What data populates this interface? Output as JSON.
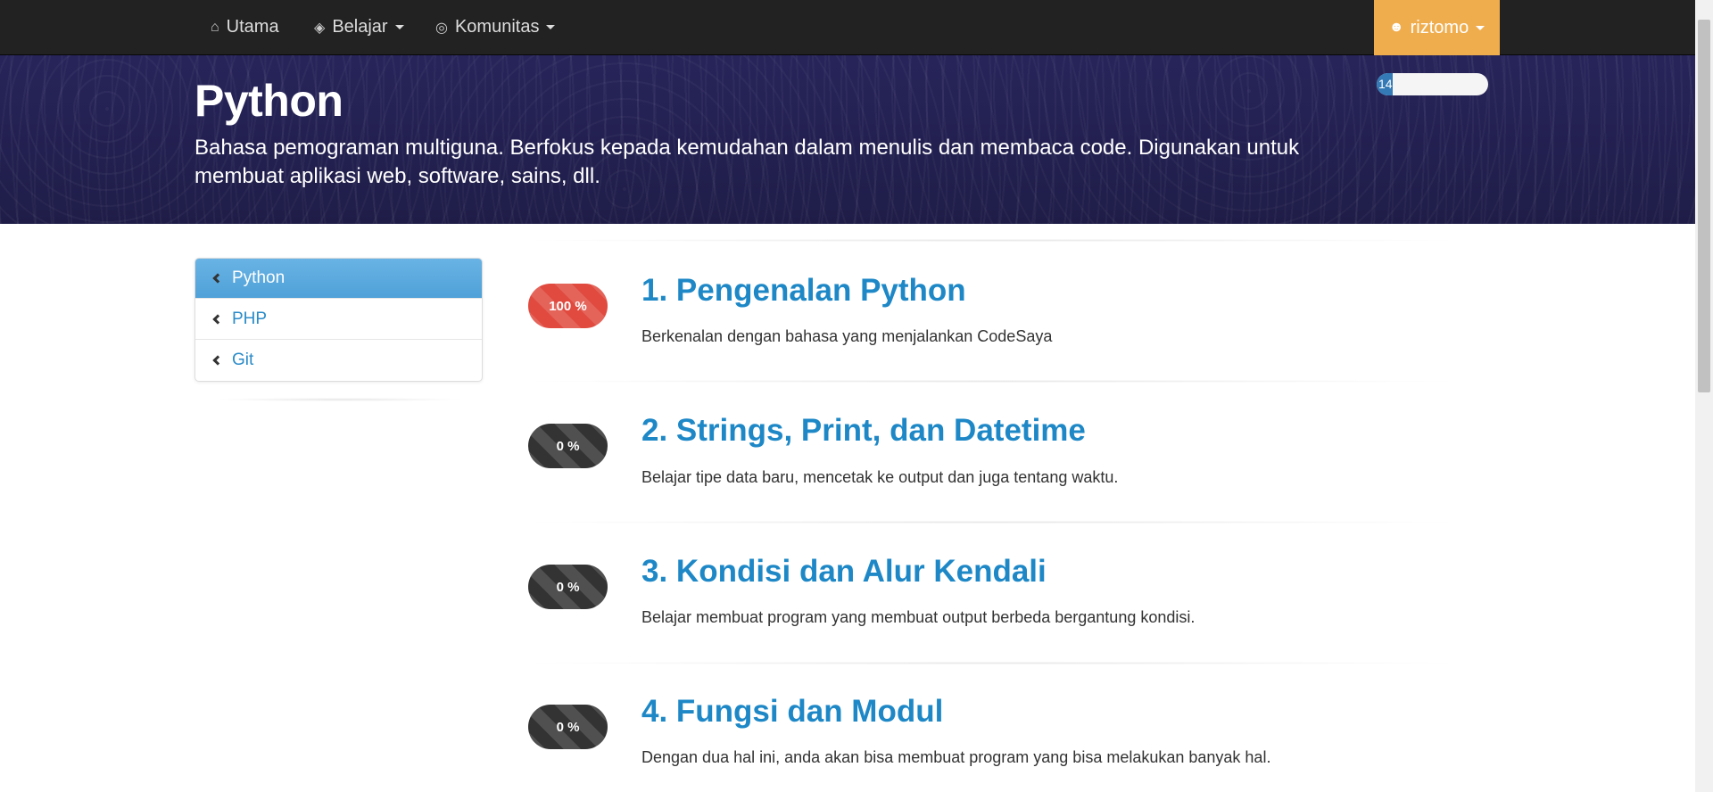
{
  "navbar": {
    "items": [
      {
        "label": "Utama",
        "icon": "home-icon"
      },
      {
        "label": "Belajar",
        "icon": "graduation-cap-icon"
      },
      {
        "label": "Komunitas",
        "icon": "globe-icon"
      }
    ],
    "user": {
      "label": "riztomo",
      "icon": "user-icon",
      "color": "#f0ad4e"
    }
  },
  "hero": {
    "title": "Python",
    "description": "Bahasa pemograman multiguna. Berfokus kepada kemudahan dalam menulis dan membaca code. Digunakan untuk membuat aplikasi web, software, sains, dll.",
    "xp": {
      "value": "14",
      "progress": 0.14
    }
  },
  "sidebar": {
    "items": [
      {
        "label": "Python",
        "active": true
      },
      {
        "label": "PHP",
        "active": false
      },
      {
        "label": "Git",
        "active": false
      }
    ]
  },
  "lessons": [
    {
      "title": "1. Pengenalan Python",
      "description": "Berkenalan dengan bahasa yang menjalankan CodeSaya",
      "progress": "100 %",
      "complete": true
    },
    {
      "title": "2. Strings, Print, dan Datetime",
      "description": "Belajar tipe data baru, mencetak ke output dan juga tentang waktu.",
      "progress": "0 %",
      "complete": false
    },
    {
      "title": "3. Kondisi dan Alur Kendali",
      "description": "Belajar membuat program yang membuat output berbeda bergantung kondisi.",
      "progress": "0 %",
      "complete": false
    },
    {
      "title": "4. Fungsi dan Modul",
      "description": "Dengan dua hal ini, anda akan bisa membuat program yang bisa melakukan banyak hal.",
      "progress": "0 %",
      "complete": false
    }
  ],
  "colors": {
    "accent": "#1e88c7",
    "complete": "#e04a3f",
    "incomplete": "#333333",
    "hero_bg": "#24214f"
  }
}
